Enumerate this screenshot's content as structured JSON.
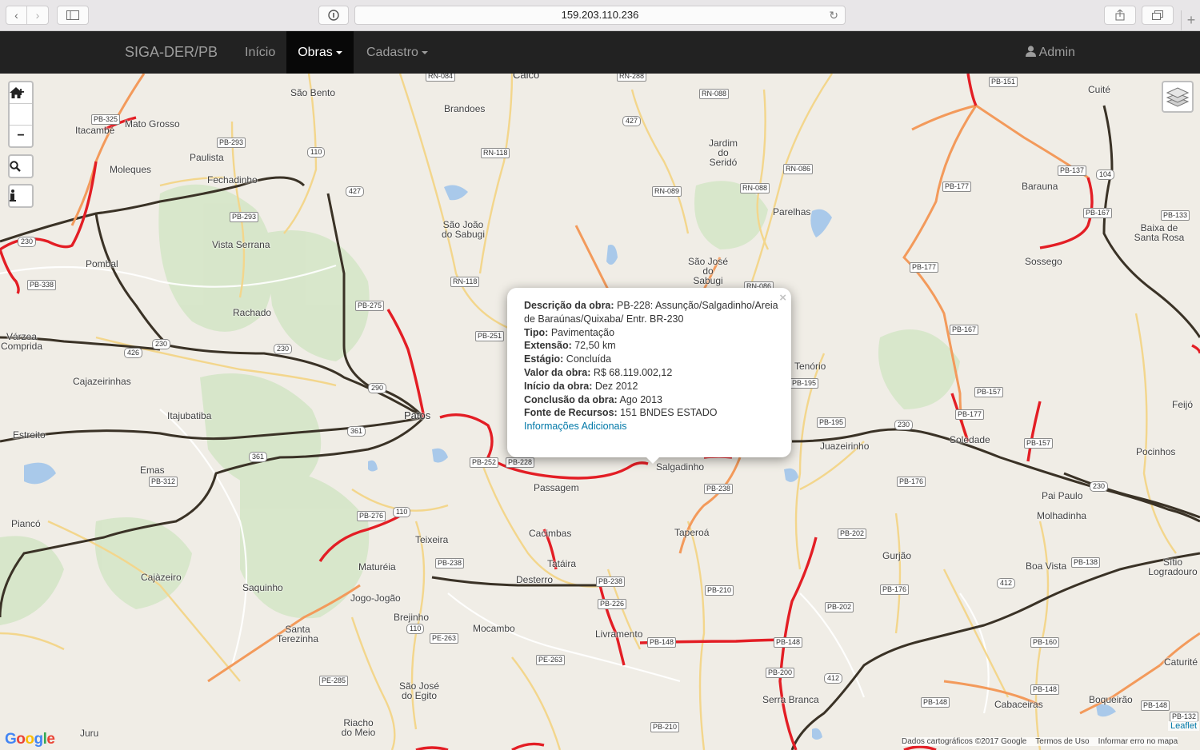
{
  "browser": {
    "url": "159.203.110.236",
    "icons": [
      "chevron-left-icon",
      "chevron-right-icon",
      "sidebar-icon",
      "reader-icon",
      "reload-icon",
      "share-icon",
      "tabs-icon",
      "plus-icon"
    ]
  },
  "navbar": {
    "brand": "SIGA-DER/PB",
    "items": [
      {
        "label": "Início"
      },
      {
        "label": "Obras",
        "active": true
      },
      {
        "label": "Cadastro"
      }
    ],
    "user": "Admin",
    "bg": "#222222",
    "active_bg": "#080808"
  },
  "map": {
    "controls": {
      "zoom_in": "+",
      "zoom_out": "−"
    },
    "places": [
      "Caicó",
      "São Bento",
      "Brandoes",
      "Mato Grosso",
      "Itacambé",
      "Paulista",
      "Moleques",
      "Fechadinho",
      "Jardim do Seridó",
      "São João do Sabugi",
      "Parelhas",
      "Vista Serrana",
      "Pombal",
      "São José do Sabugi",
      "Rachado",
      "Várzea Comprida",
      "Cajazeirinhas",
      "Itajubatiba",
      "Patos",
      "Estreito",
      "Emas",
      "Passagem",
      "Salgadinho",
      "Tenório",
      "Juazeirinho",
      "Soledade",
      "Pocinhos",
      "Feijó",
      "Barauna",
      "Baixa de Santa Rosa",
      "Sossego",
      "Cuité",
      "Pai Paulo",
      "Molhadinha",
      "Piancó",
      "Cacimbas",
      "Teixeira",
      "Taperoá",
      "Tatáira",
      "Desterro",
      "Maturéia",
      "Cajàzeiro",
      "Saquinho",
      "Jogo-Jogão",
      "Brejinho",
      "Mocambo",
      "Livramento",
      "Gurjão",
      "Boa Vista",
      "Sítio Logradouro",
      "Santa Terezinha",
      "São José do Egito",
      "Serra Branca",
      "Cabaceiras",
      "Boqueirão",
      "Riacho do Meio",
      "Caturité",
      "Juru"
    ],
    "shields": [
      "RN-084",
      "RN-288",
      "RN-088",
      "427",
      "RN-118",
      "110",
      "RN-086",
      "RN-089",
      "RN-088",
      "PB-325",
      "PB-293",
      "PB-293",
      "427",
      "230",
      "PB-338",
      "RN-118",
      "PB-275",
      "PB-251",
      "230",
      "230",
      "426",
      "290",
      "361",
      "361",
      "PB-252",
      "PB-228",
      "PB-238",
      "PB-312",
      "PB-276",
      "110",
      "PB-238",
      "PE-263",
      "PE-285",
      "110",
      "PB-238",
      "PB-226",
      "PB-210",
      "PE-263",
      "PB-148",
      "PB-202",
      "PB-202",
      "PB-148",
      "PB-200",
      "412",
      "PB-210",
      "PB-148",
      "PB-176",
      "PB-195",
      "PB-195",
      "PB-157",
      "PB-177",
      "PB-157",
      "230",
      "PB-176",
      "230",
      "412",
      "PB-138",
      "PB-160",
      "PB-148",
      "PB-148",
      "PB-132",
      "PB-151",
      "PB-137",
      "PB-177",
      "PB-167",
      "PB-133",
      "PB-177",
      "PB-167",
      "104",
      "RN-086"
    ],
    "colors": {
      "works_red": "#e31e25",
      "highway_orange": "#f39a5c",
      "federal_dark": "#3a3125",
      "state_yellow": "#f3d58b",
      "water": "#a8c8ea",
      "vegetation": "#cfe3c1"
    }
  },
  "popup": {
    "fields": [
      {
        "label": "Descrição da obra:",
        "value": "PB-228: Assunção/Salgadinho/Areia de Baraúnas/Quixaba/ Entr. BR-230"
      },
      {
        "label": "Tipo:",
        "value": "Pavimentação"
      },
      {
        "label": "Extensão:",
        "value": "72,50 km"
      },
      {
        "label": "Estágio:",
        "value": "Concluída"
      },
      {
        "label": "Valor da obra:",
        "value": "R$ 68.119.002,12"
      },
      {
        "label": "Início da obra:",
        "value": "Dez 2012"
      },
      {
        "label": "Conclusão da obra:",
        "value": "Ago 2013"
      },
      {
        "label": "Fonte de Recursos:",
        "value": "151 BNDES ESTADO"
      }
    ],
    "link": "Informações Adicionais",
    "close": "×"
  },
  "attribution": {
    "google": "Google",
    "text": "Dados cartográficos ©2017 Google",
    "terms": "Termos de Uso",
    "report": "Informar erro no mapa",
    "leaflet": "Leaflet"
  }
}
